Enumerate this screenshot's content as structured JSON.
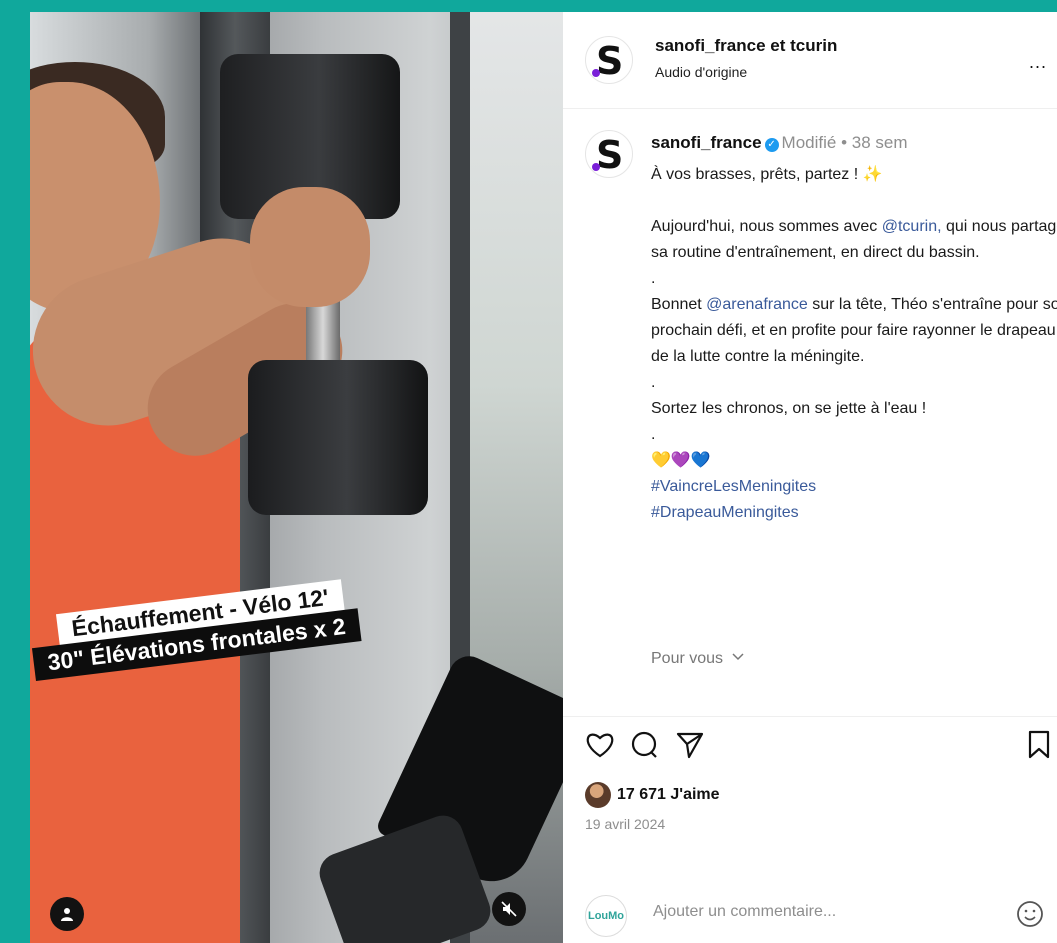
{
  "header": {
    "title": "sanofi_france et tcurin",
    "subtitle": "Audio d'origine",
    "more_label": "..."
  },
  "video": {
    "caption_line1": "Échauffement - Vélo 12'",
    "caption_line2": "30\" Élévations frontales  x 2"
  },
  "post": {
    "username": "sanofi_france",
    "verified_mark": "✓",
    "edited": "Modifié",
    "dot": " • ",
    "age": "38 sem",
    "line1": "À vos brasses, prêts, partez ! ✨",
    "p1_before": "Aujourd'hui, nous sommes avec ",
    "p1_mention": "@tcurin,",
    "p1_after": "qui nous partage sa routine d'entraînement, en direct du bassin.",
    "sep1": ".",
    "p2_before": "Bonnet ",
    "p2_mention": "@arenafrance",
    "p2_after": " sur la tête, Théo s'entraîne pour son prochain défi, et en profite pour faire rayonner le drapeau de la lutte contre la méningite.",
    "sep2": ".",
    "p3": "Sortez les chronos, on se jette à l'eau !",
    "sep3": ".",
    "hearts": [
      "💛",
      "💜",
      "💙"
    ],
    "hashtag1": "#VaincreLesMeningites",
    "hashtag2": "#DrapeauMeningites",
    "for_you": "Pour vous"
  },
  "stats": {
    "likes": "17 671 J'aime",
    "date": "19 avril 2024"
  },
  "comment": {
    "avatar_text": "LouMo",
    "placeholder": "Ajouter un commentaire..."
  },
  "icons": {
    "like": "heart-icon",
    "comment": "comment-icon",
    "share": "send-icon",
    "save": "bookmark-icon",
    "emoji": "emoji-icon",
    "user": "user-icon",
    "mute": "mute-icon"
  },
  "colors": {
    "background": "#10A89C",
    "verified": "#1d9bf0",
    "link": "#3a5a9a",
    "brand_dot": "#7a1fd8"
  }
}
